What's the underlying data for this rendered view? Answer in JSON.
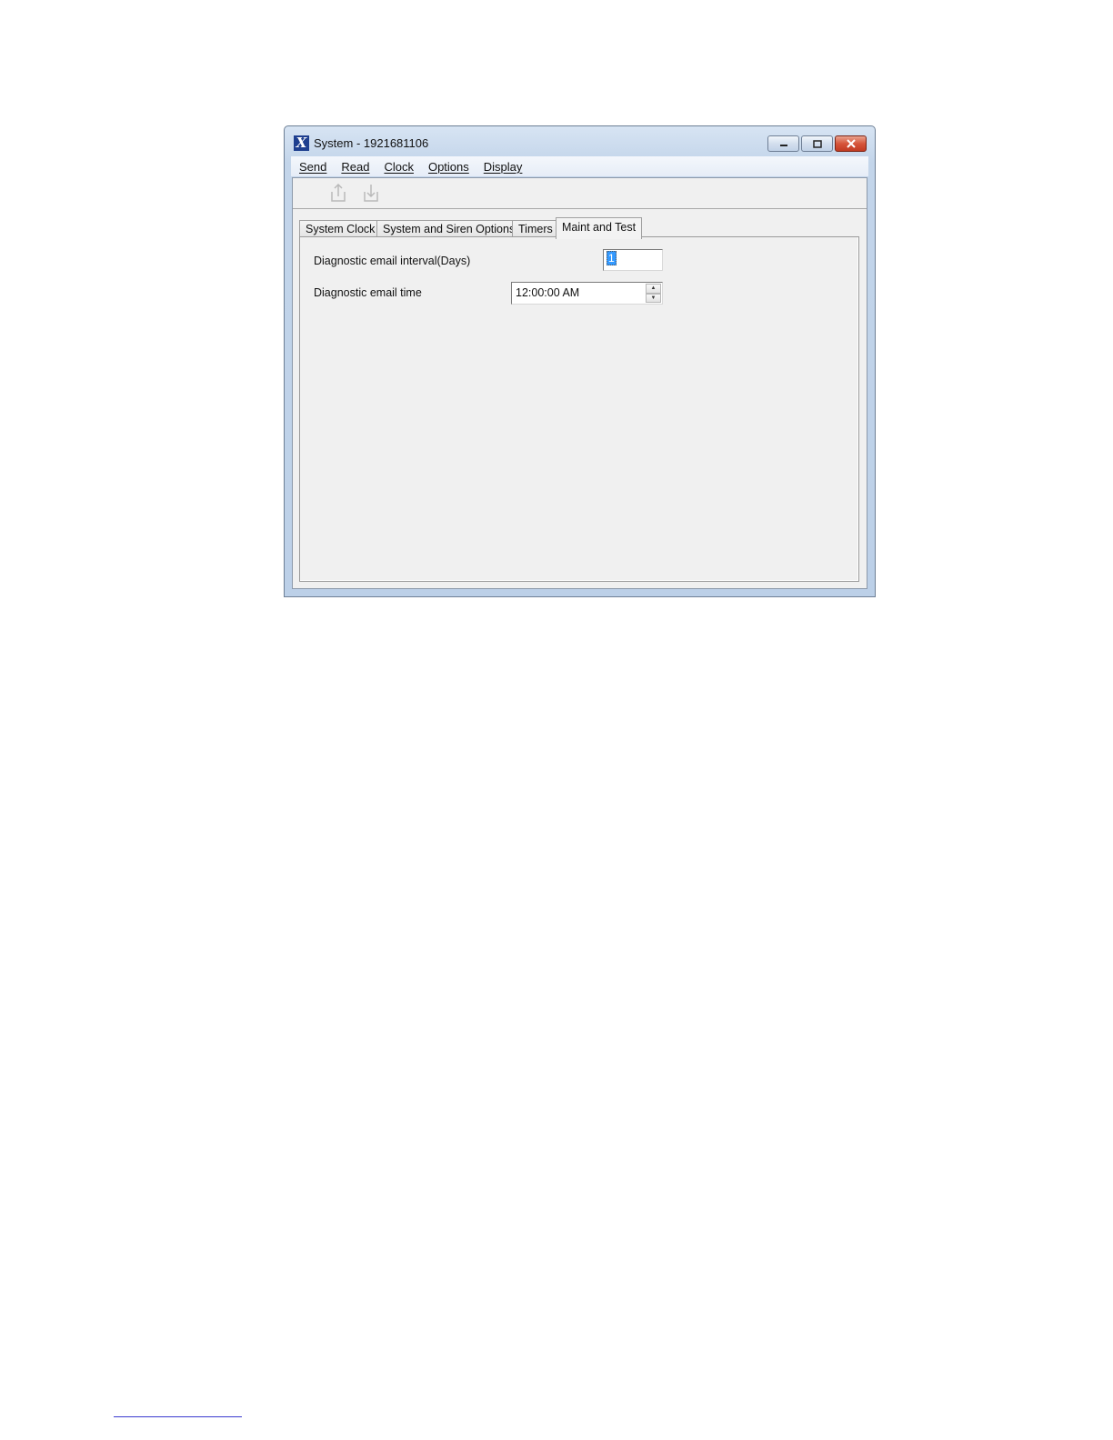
{
  "window": {
    "title": "System - 1921681106",
    "app_icon_glyph": "X",
    "controls": {
      "minimize": "minimize-icon",
      "maximize": "maximize-icon",
      "close": "close-icon"
    }
  },
  "menubar": {
    "items": [
      {
        "label": "Send"
      },
      {
        "label": "Read"
      },
      {
        "label": "Clock"
      },
      {
        "label": "Options"
      },
      {
        "label": "Display"
      }
    ]
  },
  "toolbar": {
    "buttons": [
      {
        "icon": "upload-icon"
      },
      {
        "icon": "download-icon"
      }
    ]
  },
  "tabs": {
    "items": [
      {
        "label": "System Clock"
      },
      {
        "label": "System and Siren Options"
      },
      {
        "label": "Timers"
      },
      {
        "label": "Maint and Test"
      }
    ],
    "active": "Maint and Test"
  },
  "maint": {
    "interval_label": "Diagnostic email interval(Days)",
    "interval_value": "1",
    "time_label": "Diagnostic email time",
    "time_value": "12:00:00 AM"
  },
  "colors": {
    "title_bar": "#c8d9ee",
    "close_button": "#c94a30",
    "selection": "#3399ff"
  }
}
